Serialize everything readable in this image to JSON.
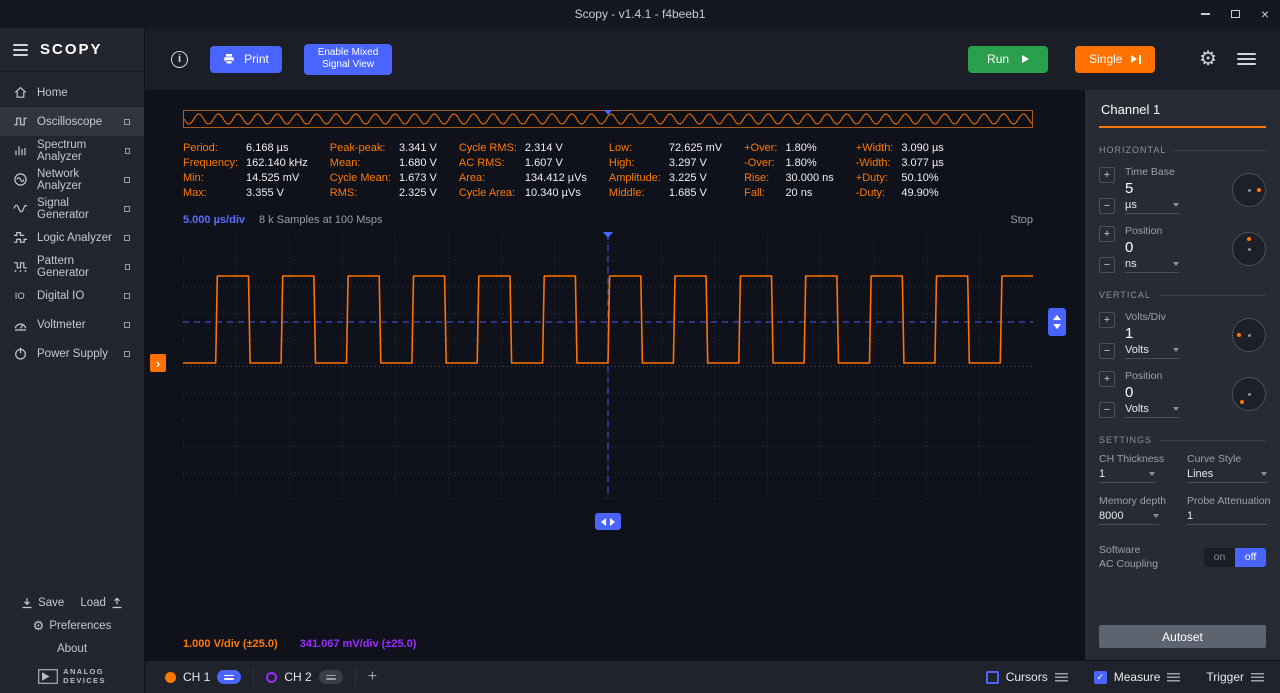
{
  "titlebar": {
    "title": "Scopy - v1.4.1 - f4beeb1"
  },
  "sidebar": {
    "logo": "SCOPY",
    "items": [
      {
        "label": "Home",
        "icon": "home-icon",
        "detach": false,
        "active": false
      },
      {
        "label": "Oscilloscope",
        "icon": "oscilloscope-icon",
        "detach": true,
        "active": true
      },
      {
        "label": "Spectrum Analyzer",
        "icon": "spectrum-analyzer-icon",
        "detach": true,
        "active": false
      },
      {
        "label": "Network Analyzer",
        "icon": "network-analyzer-icon",
        "detach": true,
        "active": false
      },
      {
        "label": "Signal Generator",
        "icon": "signal-generator-icon",
        "detach": true,
        "active": false
      },
      {
        "label": "Logic Analyzer",
        "icon": "logic-analyzer-icon",
        "detach": true,
        "active": false
      },
      {
        "label": "Pattern Generator",
        "icon": "pattern-generator-icon",
        "detach": true,
        "active": false
      },
      {
        "label": "Digital IO",
        "icon": "digital-io-icon",
        "detach": true,
        "active": false
      },
      {
        "label": "Voltmeter",
        "icon": "voltmeter-icon",
        "detach": true,
        "active": false
      },
      {
        "label": "Power Supply",
        "icon": "power-supply-icon",
        "detach": true,
        "active": false
      }
    ],
    "save_label": "Save",
    "load_label": "Load",
    "preferences_label": "Preferences",
    "about_label": "About",
    "brand": {
      "line1": "ANALOG",
      "line2": "DEVICES"
    }
  },
  "toolbar": {
    "print_label": "Print",
    "mixed_signal_label": "Enable Mixed Signal View",
    "run_label": "Run",
    "single_label": "Single"
  },
  "measurements": {
    "columns": [
      [
        {
          "label": "Period:",
          "value": "6.168 µs"
        },
        {
          "label": "Frequency:",
          "value": "162.140 kHz"
        },
        {
          "label": "Min:",
          "value": "14.525 mV"
        },
        {
          "label": "Max:",
          "value": "3.355 V"
        }
      ],
      [
        {
          "label": "Peak-peak:",
          "value": "3.341 V"
        },
        {
          "label": "Mean:",
          "value": "1.680 V"
        },
        {
          "label": "Cycle Mean:",
          "value": "1.673 V"
        },
        {
          "label": "RMS:",
          "value": "2.325 V"
        }
      ],
      [
        {
          "label": "Cycle RMS:",
          "value": "2.314 V"
        },
        {
          "label": "AC RMS:",
          "value": "1.607 V"
        },
        {
          "label": "Area:",
          "value": "134.412 µVs"
        },
        {
          "label": "Cycle Area:",
          "value": "10.340 µVs"
        }
      ],
      [
        {
          "label": "Low:",
          "value": "72.625 mV"
        },
        {
          "label": "High:",
          "value": "3.297 V"
        },
        {
          "label": "Amplitude:",
          "value": "3.225 V"
        },
        {
          "label": "Middle:",
          "value": "1.685 V"
        }
      ],
      [
        {
          "label": "+Over:",
          "value": "1.80%"
        },
        {
          "label": "-Over:",
          "value": "1.80%"
        },
        {
          "label": "Rise:",
          "value": "30.000 ns"
        },
        {
          "label": "Fall:",
          "value": "20 ns"
        }
      ],
      [
        {
          "label": "+Width:",
          "value": "3.090 µs"
        },
        {
          "label": "-Width:",
          "value": "3.077 µs"
        },
        {
          "label": "+Duty:",
          "value": "50.10%"
        },
        {
          "label": "-Duty:",
          "value": "49.90%"
        }
      ]
    ]
  },
  "plot": {
    "timebase_label": "5.000 µs/div",
    "samples_label": "8 k Samples at 100 Msps",
    "status": "Stop",
    "ch1_scale_label": "1.000 V/div (±25.0)",
    "ch2_scale_label": "341.067 mV/div (±25.0)"
  },
  "channel_panel": {
    "title": "Channel 1",
    "horizontal": {
      "section_label": "HORIZONTAL",
      "time_base": {
        "label": "Time Base",
        "value": "5",
        "unit": "µs"
      },
      "position": {
        "label": "Position",
        "value": "0",
        "unit": "ns"
      }
    },
    "vertical": {
      "section_label": "VERTICAL",
      "volts_div": {
        "label": "Volts/Div",
        "value": "1",
        "unit": "Volts"
      },
      "position": {
        "label": "Position",
        "value": "0",
        "unit": "Volts"
      }
    },
    "settings": {
      "section_label": "SETTINGS",
      "ch_thickness": {
        "label": "CH Thickness",
        "value": "1"
      },
      "curve_style": {
        "label": "Curve Style",
        "value": "Lines"
      },
      "memory_depth": {
        "label": "Memory depth",
        "value": "8000"
      },
      "probe_attenuation": {
        "label": "Probe Attenuation",
        "value": "1"
      },
      "ac_coupling": {
        "label_line1": "Software",
        "label_line2": "AC Coupling",
        "on_label": "on",
        "off_label": "off",
        "state": "off"
      },
      "autoset_label": "Autoset"
    }
  },
  "bottombar": {
    "ch1_label": "CH 1",
    "ch2_label": "CH 2",
    "add_label": "+",
    "cursors_label": "Cursors",
    "measure_label": "Measure",
    "trigger_label": "Trigger",
    "cursors_checked": false,
    "measure_checked": true
  },
  "colors": {
    "accent_orange": "#ff7200",
    "accent_blue": "#4a64ff",
    "run_green": "#2aa04d",
    "ch2_purple": "#9d2bfe"
  }
}
